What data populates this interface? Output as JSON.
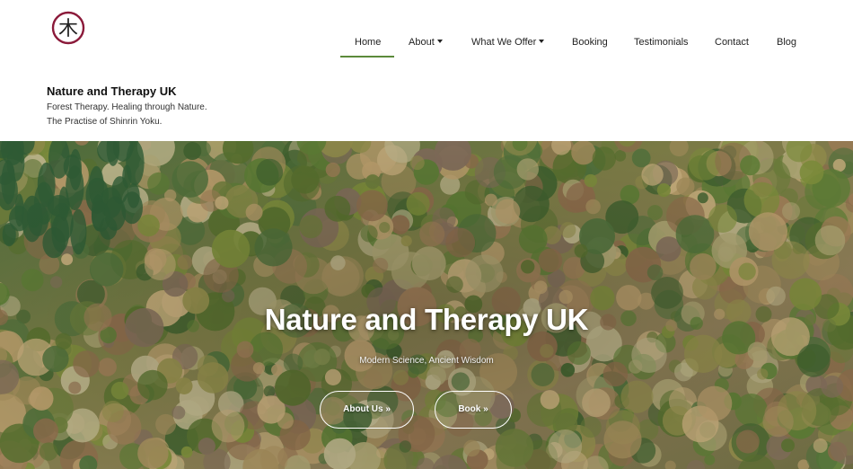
{
  "logo": {
    "icon": "tree-kanji-logo",
    "glyph": "木",
    "ring_color": "#8b1a3a"
  },
  "nav": {
    "items": [
      {
        "label": "Home",
        "active": true
      },
      {
        "label": "About",
        "dropdown": true
      },
      {
        "label": "What We Offer",
        "dropdown": true
      },
      {
        "label": "Booking"
      },
      {
        "label": "Testimonials"
      },
      {
        "label": "Contact"
      },
      {
        "label": "Blog"
      }
    ],
    "active_color": "#5b8a3a"
  },
  "site": {
    "title": "Nature and Therapy UK",
    "tagline_1": "Forest Therapy. Healing through Nature.",
    "tagline_2": "The Practise of Shinrin Yoku."
  },
  "hero": {
    "title": "Nature and Therapy UK",
    "subtitle": "Modern Science, Ancient Wisdom",
    "buttons": [
      {
        "label": "About Us »"
      },
      {
        "label": "Book »"
      }
    ]
  }
}
